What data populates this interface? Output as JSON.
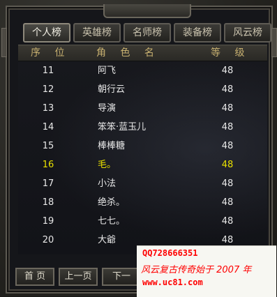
{
  "window": {
    "title": ""
  },
  "tabs": [
    {
      "label": "个人榜",
      "active": true
    },
    {
      "label": "英雄榜",
      "active": false
    },
    {
      "label": "名师榜",
      "active": false
    },
    {
      "label": "装备榜",
      "active": false
    },
    {
      "label": "风云榜",
      "active": false
    }
  ],
  "table": {
    "headers": {
      "rank": "序 位",
      "name": "角 色 名",
      "level": "等 级"
    },
    "rows": [
      {
        "rank": "11",
        "name": "阿飞",
        "level": "48"
      },
      {
        "rank": "12",
        "name": "朝行云",
        "level": "48"
      },
      {
        "rank": "13",
        "name": "导演",
        "level": "48"
      },
      {
        "rank": "14",
        "name": "笨笨·蓝玉儿",
        "level": "48"
      },
      {
        "rank": "15",
        "name": "棒棒糖",
        "level": "48"
      },
      {
        "rank": "16",
        "name": "毛。",
        "level": "48",
        "highlight": true
      },
      {
        "rank": "17",
        "name": "小法",
        "level": "48"
      },
      {
        "rank": "18",
        "name": "绝杀。",
        "level": "48"
      },
      {
        "rank": "19",
        "name": "七七。",
        "level": "48"
      },
      {
        "rank": "20",
        "name": "大爺",
        "level": "48"
      }
    ]
  },
  "pagination": {
    "first": "首 页",
    "prev": "上一页",
    "next": "下一"
  },
  "watermark": {
    "line1": "QQ728666351",
    "line2": "风云复古传奇始于 2007 年",
    "line3": "www.uc81.com"
  },
  "colors": {
    "highlight": "#e8e000",
    "header_text": "#c7b070",
    "watermark": "#ff0000"
  }
}
